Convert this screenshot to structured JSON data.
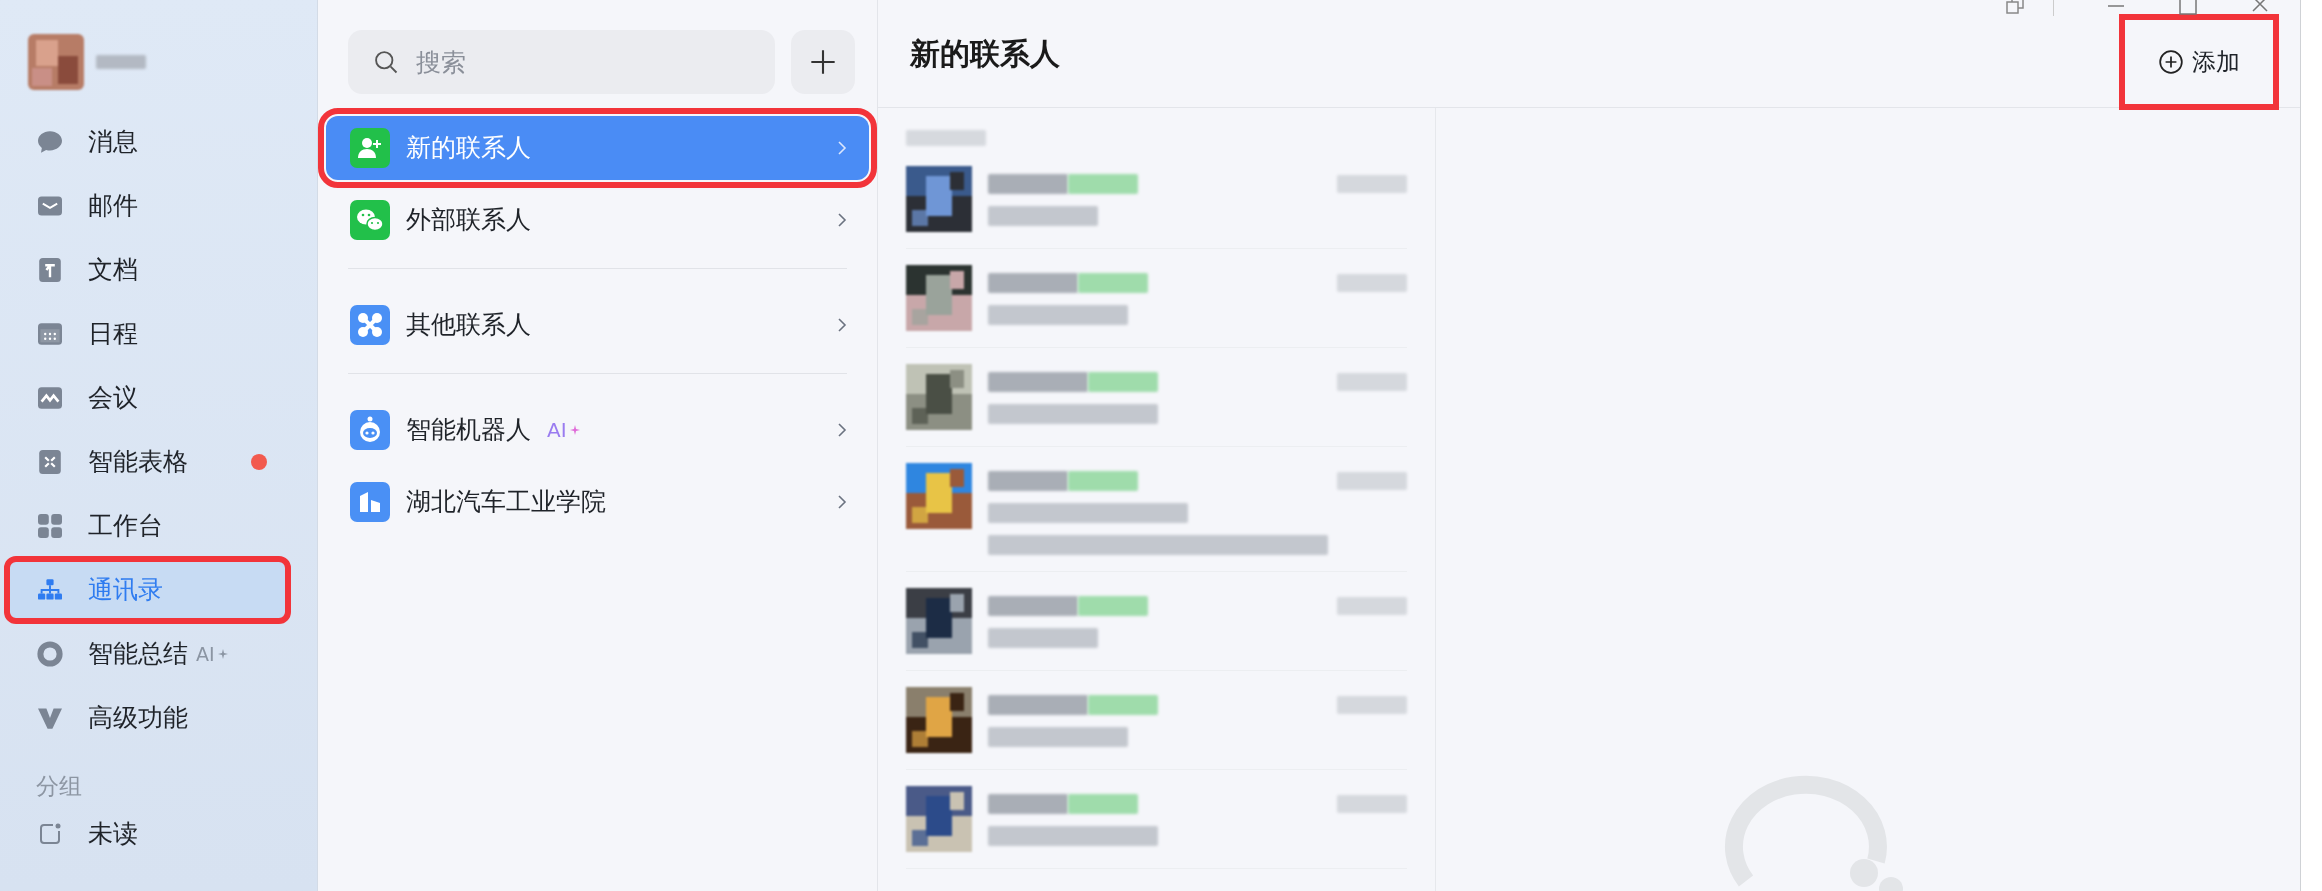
{
  "sidebar": {
    "items": [
      {
        "label": "消息",
        "selected": false,
        "highlighted": false,
        "dot": false
      },
      {
        "label": "邮件",
        "selected": false,
        "highlighted": false,
        "dot": false
      },
      {
        "label": "文档",
        "selected": false,
        "highlighted": false,
        "dot": false
      },
      {
        "label": "日程",
        "selected": false,
        "highlighted": false,
        "dot": false
      },
      {
        "label": "会议",
        "selected": false,
        "highlighted": false,
        "dot": false
      },
      {
        "label": "智能表格",
        "selected": false,
        "highlighted": false,
        "dot": true
      },
      {
        "label": "工作台",
        "selected": false,
        "highlighted": false,
        "dot": false
      },
      {
        "label": "通讯录",
        "selected": true,
        "highlighted": true,
        "dot": false
      },
      {
        "label": "智能总结",
        "badge": "AI",
        "selected": false,
        "highlighted": false,
        "dot": false
      },
      {
        "label": "高级功能",
        "selected": false,
        "highlighted": false,
        "dot": false
      }
    ],
    "group_label": "分组",
    "group_items": [
      {
        "label": "未读"
      }
    ]
  },
  "contacts_nav": {
    "search": {
      "placeholder": "搜索"
    },
    "groups": [
      {
        "items": [
          {
            "label": "新的联系人",
            "selected": true,
            "highlighted": true
          },
          {
            "label": "外部联系人",
            "selected": false,
            "highlighted": false
          }
        ]
      },
      {
        "items": [
          {
            "label": "其他联系人",
            "selected": false,
            "highlighted": false
          }
        ]
      },
      {
        "items": [
          {
            "label": "智能机器人",
            "badge": "AI",
            "selected": false,
            "highlighted": false
          },
          {
            "label": "湖北汽车工业学院",
            "selected": false,
            "highlighted": false
          }
        ]
      }
    ]
  },
  "main": {
    "title": "新的联系人",
    "add_button": {
      "label": "添加",
      "highlighted": true
    },
    "requests": [
      {
        "kind": "picture",
        "wrapped": false
      },
      {
        "kind": "picture",
        "wrapped": false
      },
      {
        "kind": "picture",
        "wrapped": false
      },
      {
        "kind": "picture",
        "wrapped": true
      },
      {
        "kind": "picture",
        "wrapped": false
      },
      {
        "kind": "picture",
        "wrapped": false
      },
      {
        "kind": "picture",
        "wrapped": false
      }
    ]
  }
}
